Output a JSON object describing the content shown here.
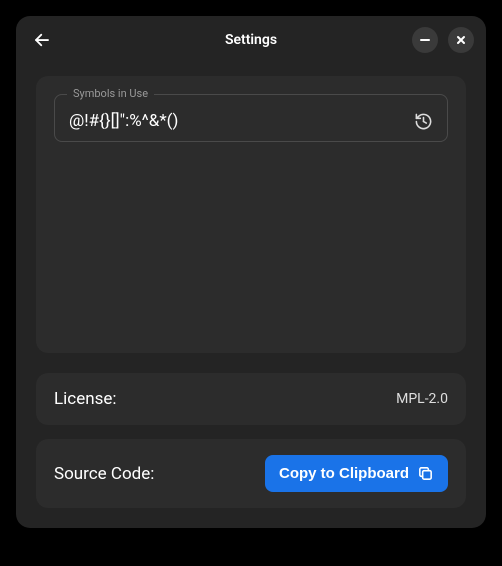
{
  "header": {
    "title": "Settings"
  },
  "symbols": {
    "label": "Symbols in Use",
    "value": "@!#{}[]\":%^&*()"
  },
  "license": {
    "label": "License:",
    "value": "MPL-2.0"
  },
  "source": {
    "label": "Source Code:",
    "button": "Copy to Clipboard"
  }
}
